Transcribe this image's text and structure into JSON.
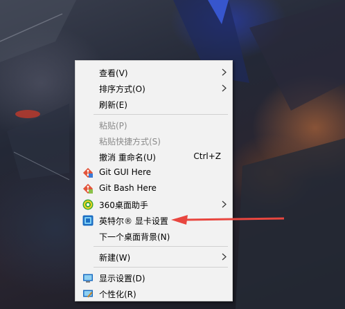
{
  "menu": {
    "items": [
      {
        "label": "查看(V)"
      },
      {
        "label": "排序方式(O)"
      },
      {
        "label": "刷新(E)"
      },
      {
        "label": "粘贴(P)"
      },
      {
        "label": "粘贴快捷方式(S)"
      },
      {
        "label": "撤消 重命名(U)",
        "shortcut": "Ctrl+Z"
      },
      {
        "label": "Git GUI Here",
        "icon": "git-gui-icon"
      },
      {
        "label": "Git Bash Here",
        "icon": "git-bash-icon"
      },
      {
        "label": "360桌面助手",
        "icon": "360-desktop-icon"
      },
      {
        "label": "英特尔® 显卡设置",
        "icon": "intel-graphics-icon"
      },
      {
        "label": "下一个桌面背景(N)"
      },
      {
        "label": "新建(W)"
      },
      {
        "label": "显示设置(D)",
        "icon": "display-settings-icon"
      },
      {
        "label": "个性化(R)",
        "icon": "personalize-icon"
      }
    ]
  },
  "colors": {
    "menu_bg": "#f2f2f2",
    "disabled_text": "#8a8a8a",
    "arrow_annotation": "#e8463f"
  }
}
